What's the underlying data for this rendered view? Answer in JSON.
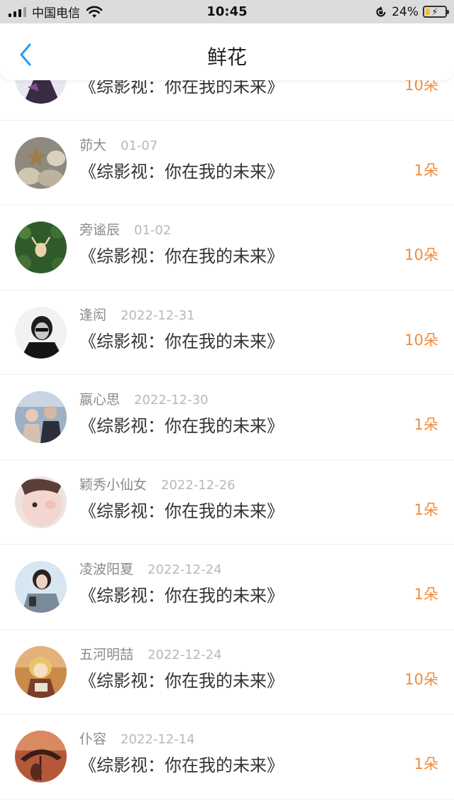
{
  "status_bar": {
    "carrier": "中国电信",
    "time": "10:45",
    "battery_percent": "24%",
    "battery_level": 0.24,
    "icons": [
      "signal-icon",
      "wifi-icon",
      "orientation-lock-icon",
      "battery-icon"
    ]
  },
  "header": {
    "title": "鲜花",
    "back_icon": "chevron-left-icon"
  },
  "colors": {
    "accent_blue": "#2a9df4",
    "count_orange": "#f08b3c",
    "status_bar_bg": "#dcdcdc"
  },
  "records": [
    {
      "name": "",
      "date": "",
      "title": "《综影视：你在我的未来》",
      "count": "10朵"
    },
    {
      "name": "茆大",
      "date": "01-07",
      "title": "《综影视：你在我的未来》",
      "count": "1朵"
    },
    {
      "name": "旁谧辰",
      "date": "01-02",
      "title": "《综影视：你在我的未来》",
      "count": "10朵"
    },
    {
      "name": "逢闳",
      "date": "2022-12-31",
      "title": "《综影视：你在我的未来》",
      "count": "10朵"
    },
    {
      "name": "嬴心思",
      "date": "2022-12-30",
      "title": "《综影视：你在我的未来》",
      "count": "1朵"
    },
    {
      "name": "颖秀小仙女",
      "date": "2022-12-26",
      "title": "《综影视：你在我的未来》",
      "count": "1朵"
    },
    {
      "name": "凌波阳夏",
      "date": "2022-12-24",
      "title": "《综影视：你在我的未来》",
      "count": "1朵"
    },
    {
      "name": "五河明喆",
      "date": "2022-12-24",
      "title": "《综影视：你在我的未来》",
      "count": "10朵"
    },
    {
      "name": "仆容",
      "date": "2022-12-14",
      "title": "《综影视：你在我的未来》",
      "count": "1朵"
    }
  ]
}
